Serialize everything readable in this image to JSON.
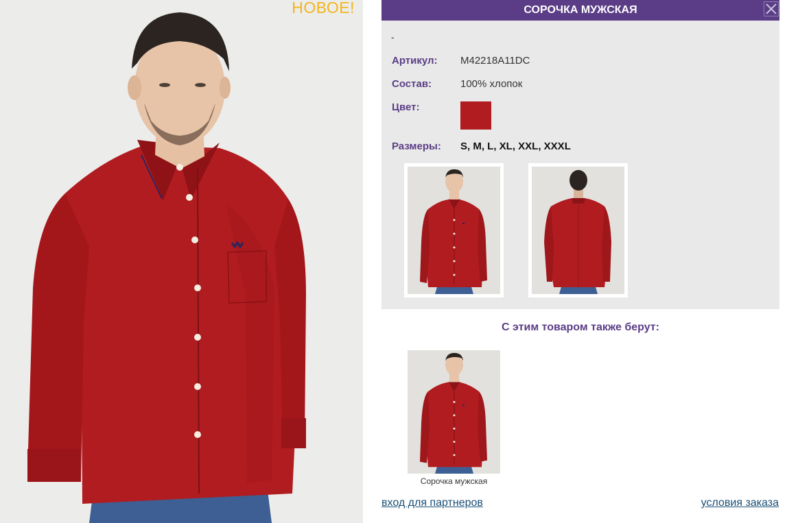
{
  "main_photo": {
    "badge": "НОВОЕ!"
  },
  "product": {
    "title": "СОРОЧКА МУЖСКАЯ",
    "subtitle": "-",
    "article_label": "Артикул:",
    "article_value": "M42218A11DC",
    "composition_label": "Состав:",
    "composition_value": "100% хлопок",
    "color_label": "Цвет:",
    "color_swatch": "#b11c20",
    "sizes_label": "Размеры:",
    "sizes_value": "S, M, L, XL, XXL, XXXL",
    "thumbnails": [
      "front-view",
      "back-view"
    ]
  },
  "colors": {
    "accent": "#5a3d86",
    "shirt": "#b11c20",
    "badge": "#f2b51e",
    "link": "#1a4f75"
  },
  "related": {
    "title": "С этим товаром также берут:",
    "items": [
      {
        "caption": "Сорочка мужская"
      }
    ]
  },
  "footer": {
    "partners_link": "вход для партнеров",
    "terms_link": "условия заказа"
  }
}
